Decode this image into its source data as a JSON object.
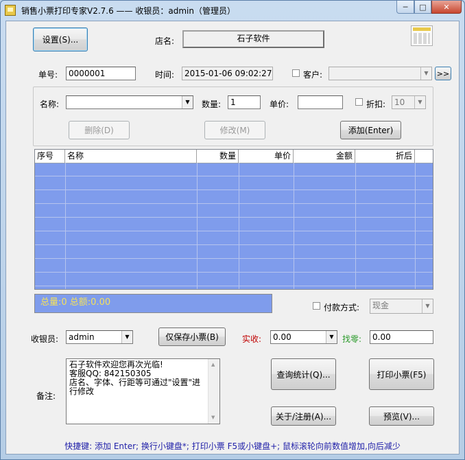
{
  "window": {
    "title": "销售小票打印专家V2.7.6 —— 收银员：admin（管理员）",
    "min_glyph": "─",
    "max_glyph": "□",
    "close_glyph": "✕"
  },
  "header": {
    "settings_button": "设置(S)...",
    "shop_label": "店名:",
    "shop_name": "石子软件"
  },
  "order": {
    "number_label": "单号:",
    "number_value": "0000001",
    "time_label": "时间:",
    "time_value": "2015-01-06 09:02:27",
    "customer_label": "客户:",
    "customer_value": "",
    "more_button": ">>"
  },
  "item": {
    "name_label": "名称:",
    "name_value": "",
    "qty_label": "数量:",
    "qty_value": "1",
    "price_label": "单价:",
    "price_value": "",
    "discount_label": "折扣:",
    "discount_value": "10",
    "delete_button": "删除(D)",
    "modify_button": "修改(M)",
    "add_button": "添加(Enter)"
  },
  "table": {
    "columns": [
      "序号",
      "名称",
      "数量",
      "单价",
      "金额",
      "折后"
    ],
    "rows": []
  },
  "totals": {
    "text": "总量:0  总额:0.00"
  },
  "payment": {
    "label": "付款方式:",
    "value": "现金"
  },
  "checkout": {
    "cashier_label": "收银员:",
    "cashier_value": "admin",
    "save_only_button": "仅保存小票(B)",
    "paid_label": "实收:",
    "paid_value": "0.00",
    "change_label": "找零:",
    "change_value": "0.00",
    "memo_label": "备注:",
    "memo_text": "石子软件欢迎您再次光临!\n客服QQ: 842150305\n店名、字体、行距等可通过\"设置\"进行修改",
    "query_button": "查询统计(Q)...",
    "print_button": "打印小票(F5)",
    "about_button": "关于/注册(A)...",
    "preview_button": "预览(V)..."
  },
  "status": {
    "text": "快捷键: 添加 Enter; 换行小键盘*; 打印小票 F5或小键盘+; 鼠标滚轮向前数值增加,向后减少"
  },
  "colors": {
    "grid_background": "#7f9cec",
    "totals_text": "#f5e15a",
    "paid_label": "#c00000",
    "change_label": "#2a9a2a",
    "status_text": "#1e1ea8"
  },
  "icons": {
    "app": "receipt-printer-icon",
    "calculator": "calculator-icon"
  }
}
